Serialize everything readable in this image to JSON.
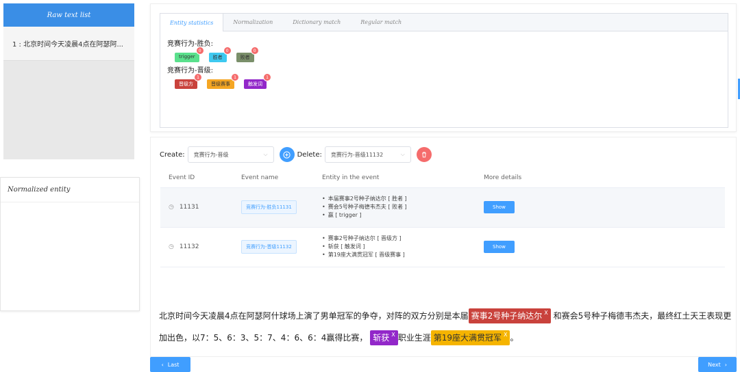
{
  "left": {
    "header": "Raw text list",
    "items": [
      "1 : 北京时间今天凌晨4点在阿瑟阿..."
    ]
  },
  "normalized": {
    "header": "Normalized entity"
  },
  "tabs": [
    "Entity statistics",
    "Normalization",
    "Dictionary match",
    "Regular match"
  ],
  "stats": {
    "groups": [
      {
        "title": "竞赛行为-胜负:",
        "tags": [
          {
            "label": "trigger",
            "count": "0",
            "color": "#5ae08c"
          },
          {
            "label": "胜者",
            "count": "0",
            "color": "#3ec9f0"
          },
          {
            "label": "败者",
            "count": "0",
            "color": "#7a8f6a"
          }
        ]
      },
      {
        "title": "竞赛行为-晋级:",
        "tags": [
          {
            "label": "晋级方",
            "count": "1",
            "color": "#c9423c"
          },
          {
            "label": "晋级赛事",
            "count": "1",
            "color": "#f5a623"
          },
          {
            "label": "触发词",
            "count": "1",
            "color": "#9227c9"
          }
        ]
      }
    ]
  },
  "controls": {
    "create_label": "Create:",
    "create_value": "竞赛行为-晋级",
    "delete_label": "Delete:",
    "delete_value": "竞赛行为-晋级11132"
  },
  "table": {
    "headers": [
      "Event ID",
      "Event name",
      "Entity in the event",
      "More details"
    ],
    "rows": [
      {
        "id": "11131",
        "name": "竞赛行为-胜负11131",
        "entities": [
          "本届赛事2号种子纳达尔 [ 胜者 ]",
          "赛会5号种子梅德韦杰夫 [ 败者 ]",
          "赢 [ trigger ]"
        ],
        "button": "Show"
      },
      {
        "id": "11132",
        "name": "竞赛行为-晋级11132",
        "entities": [
          "赛事2号种子纳达尔 [ 晋级方 ]",
          "斩获 [ 触发词 ]",
          "第19座大满贯冠军 [ 晋级赛事 ]"
        ],
        "button": "Show"
      }
    ]
  },
  "text": {
    "part1": "北京时间今天凌晨4点在阿瑟阿什球场上演了男单冠军的争夺，对阵的双方分别是本届",
    "hl1": "赛事2号种子纳达尔",
    "part2": "和赛会5号种子梅德韦杰夫，最终红土天王表现更加出色，以7：5、6：3、5：7、4：6、6：4赢得比赛，",
    "hl2": "斩获",
    "part3": "职业生涯",
    "hl3": "第19座大满贯冠军",
    "part4": "。",
    "close": "X"
  },
  "nav": {
    "last": "Last",
    "next": "Next"
  }
}
